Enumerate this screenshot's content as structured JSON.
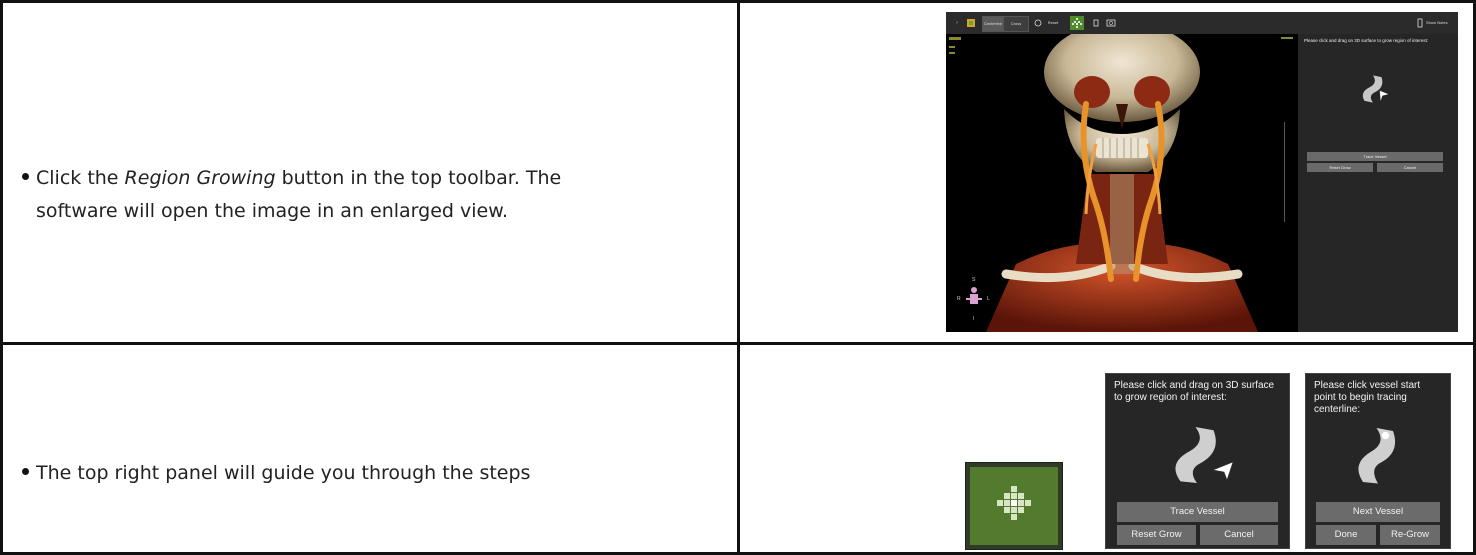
{
  "rows": [
    {
      "text_before": "Click the ",
      "text_emph": "Region Growing",
      "text_line1_after": " button in the top toolbar. The",
      "text_line2": "software will open the image in an enlarged view."
    },
    {
      "text": "The top right panel will guide you through the steps"
    }
  ],
  "app_screenshot": {
    "toolbar": {
      "tab_centerline": "Centerline",
      "tab_cross_section": "Cross Section",
      "reset_views": "Reset Views",
      "show_notes": "Show Notes"
    },
    "panel": {
      "instruction": "Please click and drag on 3D surface to grow region of interest:",
      "trace_button": "Trace Vessel",
      "reset_button": "Reset Grow",
      "cancel_button": "Cancel"
    },
    "orientation": {
      "s": "S",
      "r": "R",
      "l": "L",
      "i": "I"
    }
  },
  "panel_grow": {
    "instruction": "Please click and drag on 3D surface to grow region of interest:",
    "trace_button": "Trace Vessel",
    "reset_button": "Reset Grow",
    "cancel_button": "Cancel"
  },
  "panel_trace": {
    "instruction": "Please click vessel start point to begin tracing centerline:",
    "next_button": "Next Vessel",
    "done_button": "Done",
    "regrow_button": "Re-Grow"
  },
  "icons": {
    "region_growing": "region-growing-icon",
    "vessel": "vessel-icon",
    "cursor": "cursor-arrow-icon"
  },
  "colors": {
    "accent_green": "#537b2e",
    "panel_bg": "#262626",
    "button_gray": "#6b6b6b",
    "vessel_orange": "#e8922a",
    "bone": "#d9cdb7"
  }
}
